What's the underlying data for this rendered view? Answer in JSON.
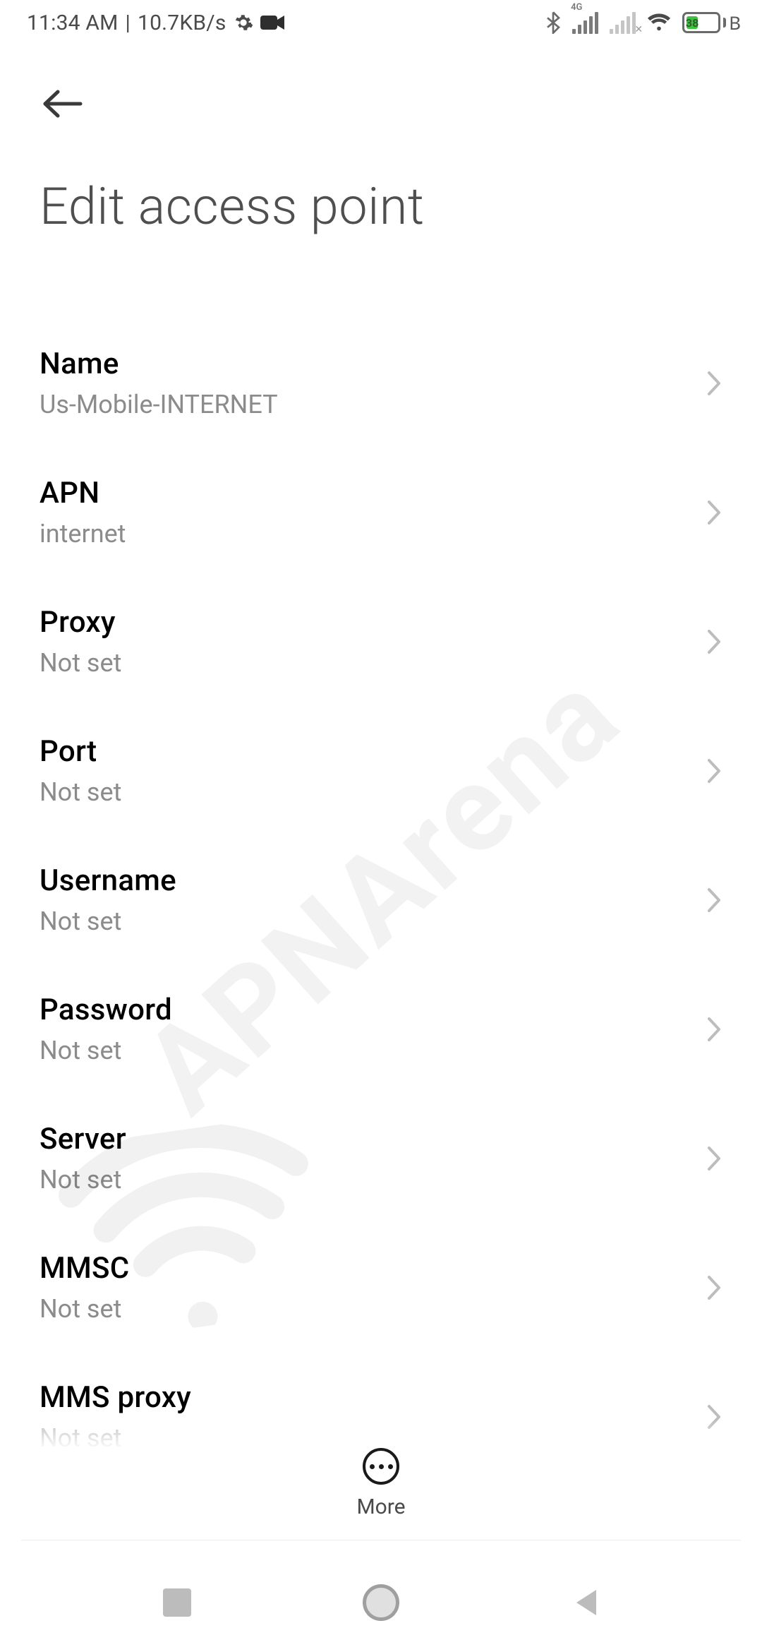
{
  "status": {
    "time": "11:34 AM",
    "separator": " | ",
    "speed": "10.7KB/s",
    "network_label_4g": "4G",
    "battery_pct": "38"
  },
  "header": {
    "title": "Edit access point"
  },
  "rows": [
    {
      "id": "name",
      "title": "Name",
      "value": "Us-Mobile-INTERNET"
    },
    {
      "id": "apn",
      "title": "APN",
      "value": "internet"
    },
    {
      "id": "proxy",
      "title": "Proxy",
      "value": "Not set"
    },
    {
      "id": "port",
      "title": "Port",
      "value": "Not set"
    },
    {
      "id": "username",
      "title": "Username",
      "value": "Not set"
    },
    {
      "id": "password",
      "title": "Password",
      "value": "Not set"
    },
    {
      "id": "server",
      "title": "Server",
      "value": "Not set"
    },
    {
      "id": "mmsc",
      "title": "MMSC",
      "value": "Not set"
    },
    {
      "id": "mmsproxy",
      "title": "MMS proxy",
      "value": "Not set"
    }
  ],
  "bottom": {
    "more_label": "More"
  },
  "watermark": {
    "text": "APNArena"
  }
}
